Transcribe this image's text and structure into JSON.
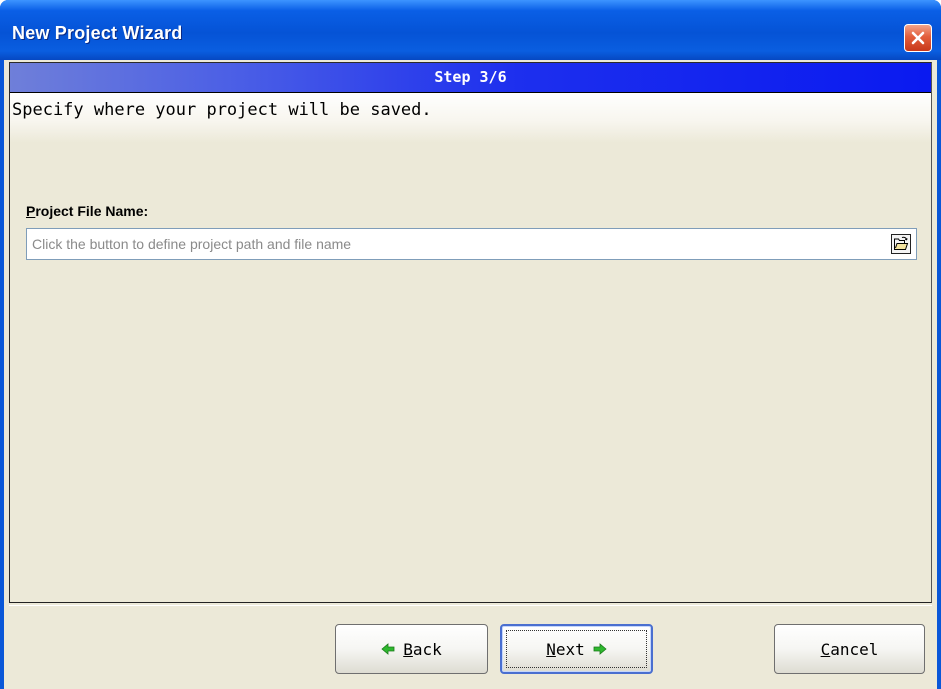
{
  "window": {
    "title": "New Project Wizard",
    "close_icon": "close-icon"
  },
  "wizard": {
    "step_label": "Step 3/6",
    "description": "Specify where your project will be saved."
  },
  "project_file": {
    "label_mnemonic": "P",
    "label_rest": "roject File Name:",
    "value": "",
    "placeholder": "Click the button to define project path and file name",
    "browse_icon": "open-folder-icon"
  },
  "buttons": {
    "back": {
      "mnemonic": "B",
      "rest": "ack",
      "icon": "arrow-left-icon"
    },
    "next": {
      "mnemonic": "N",
      "rest": "ext",
      "icon": "arrow-right-icon"
    },
    "cancel": {
      "mnemonic": "C",
      "rest": "ancel"
    }
  },
  "colors": {
    "titlebar_blue": "#0553d6",
    "step_header_blue": "#0a1af0",
    "dialog_background": "#ece9d8",
    "arrow_green": "#2eb82e",
    "close_red": "#d9441f"
  }
}
